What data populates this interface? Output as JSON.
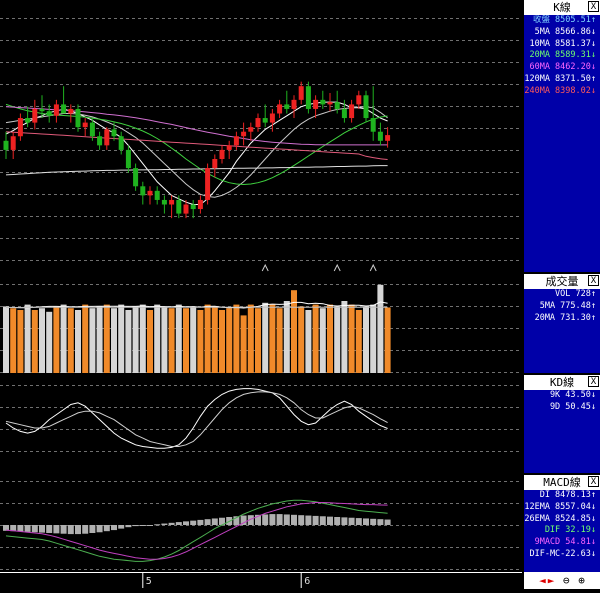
{
  "colors": {
    "up": "#ee2222",
    "down": "#1fb31f",
    "vol_up": "#f08a2a",
    "vol_down": "#d6d6d6",
    "grid": "#707070",
    "panel_bg": "#0000a8",
    "ma5": "#ffffff",
    "ma10": "#c8c8c8",
    "ma20": "#3fd13f",
    "ma60": "#d070d0",
    "ma120": "#e0e0e0",
    "ma240": "#e05a7a",
    "macd_bar": "#b0b0b0",
    "dif": "#4caf50",
    "macd": "#c040c0"
  },
  "k_panel": {
    "title": "K線",
    "close_btn": "X",
    "rows": [
      {
        "text": "收盤 8505.51↑",
        "color": "#7fd4ff"
      },
      {
        "text": "5MA 8566.86↓",
        "color": "#ffffff"
      },
      {
        "text": "10MA 8581.37↓",
        "color": "#ffffff"
      },
      {
        "text": "20MA 8589.31↓",
        "color": "#6fff6f"
      },
      {
        "text": "60MA 8462.20↓",
        "color": "#ff66ff"
      },
      {
        "text": "120MA 8371.50↑",
        "color": "#ffffff"
      },
      {
        "text": "240MA 8398.02↓",
        "color": "#ff5a5a"
      }
    ]
  },
  "vol_panel": {
    "title": "成交量",
    "close_btn": "X",
    "rows": [
      {
        "text": "VOL 728↑",
        "color": "#ffffff"
      },
      {
        "text": "5MA 775.48↑",
        "color": "#ffffff"
      },
      {
        "text": "20MA 731.30↑",
        "color": "#ffffff"
      }
    ]
  },
  "kd_panel": {
    "title": "KD線",
    "close_btn": "X",
    "rows": [
      {
        "text": "9K 43.50↓",
        "color": "#ffffff"
      },
      {
        "text": "9D 50.45↓",
        "color": "#ffffff"
      }
    ]
  },
  "macd_panel": {
    "title": "MACD線",
    "close_btn": "X",
    "rows": [
      {
        "text": "DI 8478.13↑",
        "color": "#ffffff"
      },
      {
        "text": "12EMA 8557.04↓",
        "color": "#ffffff"
      },
      {
        "text": "26EMA 8524.85↓",
        "color": "#ffffff"
      },
      {
        "text": "DIF 32.19↓",
        "color": "#6fff6f"
      },
      {
        "text": "9MACD 54.81↓",
        "color": "#ff66ff"
      },
      {
        "text": "DIF-MC-22.63↓",
        "color": "#ffffff"
      }
    ]
  },
  "toolbar": {
    "left": "◄",
    "right": "►",
    "zoom_out": "⊖",
    "zoom_in": "⊕"
  },
  "chart_data": {
    "type": "candlestick",
    "x_ticks": [
      {
        "label": "5",
        "index": 19
      },
      {
        "label": "6",
        "index": 41
      }
    ],
    "candles": [
      [
        8480,
        8520,
        8400,
        8440
      ],
      [
        8440,
        8520,
        8400,
        8500
      ],
      [
        8500,
        8600,
        8480,
        8580
      ],
      [
        8580,
        8630,
        8540,
        8560
      ],
      [
        8560,
        8660,
        8530,
        8620
      ],
      [
        8620,
        8680,
        8580,
        8610
      ],
      [
        8610,
        8640,
        8560,
        8590
      ],
      [
        8590,
        8660,
        8560,
        8640
      ],
      [
        8640,
        8720,
        8600,
        8600
      ],
      [
        8600,
        8640,
        8560,
        8620
      ],
      [
        8620,
        8640,
        8520,
        8540
      ],
      [
        8540,
        8580,
        8500,
        8560
      ],
      [
        8560,
        8580,
        8480,
        8500
      ],
      [
        8500,
        8520,
        8440,
        8460
      ],
      [
        8460,
        8540,
        8440,
        8530
      ],
      [
        8530,
        8560,
        8480,
        8500
      ],
      [
        8500,
        8520,
        8420,
        8440
      ],
      [
        8440,
        8460,
        8340,
        8360
      ],
      [
        8360,
        8380,
        8260,
        8280
      ],
      [
        8280,
        8300,
        8200,
        8240
      ],
      [
        8240,
        8280,
        8200,
        8260
      ],
      [
        8260,
        8280,
        8200,
        8220
      ],
      [
        8220,
        8240,
        8160,
        8200
      ],
      [
        8200,
        8240,
        8140,
        8220
      ],
      [
        8220,
        8240,
        8140,
        8160
      ],
      [
        8160,
        8220,
        8140,
        8200
      ],
      [
        8200,
        8220,
        8140,
        8180
      ],
      [
        8180,
        8240,
        8160,
        8220
      ],
      [
        8220,
        8380,
        8200,
        8360
      ],
      [
        8360,
        8420,
        8320,
        8400
      ],
      [
        8400,
        8460,
        8380,
        8440
      ],
      [
        8440,
        8480,
        8400,
        8460
      ],
      [
        8460,
        8520,
        8440,
        8500
      ],
      [
        8500,
        8560,
        8460,
        8520
      ],
      [
        8520,
        8560,
        8480,
        8540
      ],
      [
        8540,
        8600,
        8520,
        8580
      ],
      [
        8580,
        8640,
        8540,
        8560
      ],
      [
        8560,
        8620,
        8520,
        8600
      ],
      [
        8600,
        8660,
        8580,
        8640
      ],
      [
        8640,
        8700,
        8600,
        8620
      ],
      [
        8620,
        8680,
        8580,
        8660
      ],
      [
        8660,
        8740,
        8640,
        8720
      ],
      [
        8720,
        8740,
        8600,
        8620
      ],
      [
        8620,
        8680,
        8580,
        8660
      ],
      [
        8660,
        8700,
        8620,
        8640
      ],
      [
        8640,
        8690,
        8610,
        8650
      ],
      [
        8650,
        8700,
        8600,
        8620
      ],
      [
        8620,
        8660,
        8560,
        8580
      ],
      [
        8580,
        8660,
        8560,
        8640
      ],
      [
        8640,
        8700,
        8620,
        8680
      ],
      [
        8680,
        8700,
        8560,
        8580
      ],
      [
        8580,
        8720,
        8480,
        8520
      ],
      [
        8520,
        8560,
        8460,
        8480
      ],
      [
        8480,
        8540,
        8450,
        8505
      ]
    ],
    "ma_lines": [
      {
        "key": "ma5",
        "values": [
          8510,
          8525,
          8545,
          8560,
          8580,
          8590,
          8605,
          8610,
          8620,
          8610,
          8600,
          8585,
          8570,
          8550,
          8530,
          8515,
          8495,
          8460,
          8420,
          8380,
          8340,
          8300,
          8270,
          8240,
          8225,
          8210,
          8200,
          8200,
          8225,
          8260,
          8300,
          8340,
          8390,
          8430,
          8470,
          8500,
          8530,
          8550,
          8570,
          8590,
          8610,
          8630,
          8640,
          8645,
          8650,
          8650,
          8650,
          8640,
          8625,
          8625,
          8620,
          8600,
          8580,
          8567
        ]
      },
      {
        "key": "ma10",
        "values": [
          8560,
          8565,
          8570,
          8575,
          8580,
          8585,
          8590,
          8595,
          8600,
          8600,
          8598,
          8592,
          8585,
          8575,
          8563,
          8550,
          8535,
          8515,
          8495,
          8470,
          8440,
          8410,
          8380,
          8350,
          8320,
          8290,
          8265,
          8245,
          8235,
          8232,
          8240,
          8255,
          8275,
          8300,
          8330,
          8365,
          8400,
          8435,
          8470,
          8500,
          8530,
          8555,
          8575,
          8590,
          8600,
          8610,
          8618,
          8622,
          8625,
          8628,
          8630,
          8625,
          8605,
          8581
        ]
      },
      {
        "key": "ma20",
        "values": [
          8640,
          8630,
          8620,
          8612,
          8606,
          8600,
          8596,
          8593,
          8591,
          8589,
          8587,
          8584,
          8580,
          8575,
          8570,
          8563,
          8556,
          8547,
          8536,
          8523,
          8508,
          8490,
          8470,
          8448,
          8425,
          8400,
          8378,
          8356,
          8337,
          8320,
          8306,
          8296,
          8290,
          8288,
          8290,
          8296,
          8305,
          8318,
          8334,
          8352,
          8372,
          8392,
          8413,
          8434,
          8455,
          8475,
          8495,
          8515,
          8532,
          8548,
          8563,
          8575,
          8584,
          8589
        ]
      },
      {
        "key": "ma60",
        "values": [
          8630,
          8628,
          8626,
          8624,
          8622,
          8620,
          8618,
          8616,
          8614,
          8612,
          8610,
          8607,
          8604,
          8601,
          8597,
          8594,
          8590,
          8586,
          8581,
          8576,
          8570,
          8564,
          8558,
          8552,
          8545,
          8538,
          8531,
          8524,
          8518,
          8512,
          8506,
          8500,
          8495,
          8490,
          8485,
          8481,
          8477,
          8474,
          8471,
          8469,
          8467,
          8465,
          8464,
          8463,
          8463,
          8462,
          8462,
          8462,
          8462,
          8462,
          8462,
          8462,
          8462,
          8462
        ]
      },
      {
        "key": "ma120",
        "values": [
          8330,
          8332,
          8334,
          8336,
          8338,
          8340,
          8342,
          8343,
          8344,
          8345,
          8346,
          8347,
          8348,
          8349,
          8350,
          8350,
          8351,
          8351,
          8352,
          8352,
          8353,
          8353,
          8354,
          8354,
          8355,
          8355,
          8356,
          8356,
          8357,
          8357,
          8358,
          8358,
          8359,
          8359,
          8360,
          8360,
          8361,
          8361,
          8362,
          8362,
          8363,
          8364,
          8364,
          8365,
          8365,
          8366,
          8367,
          8367,
          8368,
          8369,
          8369,
          8370,
          8371,
          8371
        ]
      },
      {
        "key": "ma240",
        "values": [
          8520,
          8518,
          8516,
          8514,
          8512,
          8510,
          8508,
          8506,
          8504,
          8502,
          8500,
          8498,
          8496,
          8494,
          8492,
          8490,
          8488,
          8486,
          8484,
          8482,
          8480,
          8478,
          8476,
          8474,
          8472,
          8470,
          8468,
          8466,
          8464,
          8462,
          8460,
          8458,
          8456,
          8454,
          8452,
          8450,
          8448,
          8446,
          8444,
          8442,
          8440,
          8438,
          8436,
          8434,
          8432,
          8430,
          8428,
          8426,
          8424,
          8422,
          8412,
          8406,
          8401,
          8398
        ]
      }
    ],
    "k_ylim": [
      8000,
      8800
    ],
    "volume": [
      740,
      720,
      700,
      760,
      700,
      720,
      680,
      740,
      760,
      720,
      700,
      760,
      720,
      740,
      760,
      720,
      760,
      700,
      740,
      760,
      700,
      760,
      740,
      720,
      760,
      720,
      740,
      700,
      760,
      740,
      700,
      720,
      760,
      640,
      760,
      720,
      780,
      760,
      720,
      800,
      920,
      740,
      700,
      760,
      720,
      760,
      740,
      800,
      760,
      700,
      740,
      760,
      980,
      728
    ],
    "vol_ma5": [
      730,
      728,
      726,
      726,
      730,
      736,
      740,
      740,
      738,
      736,
      736,
      740,
      740,
      742,
      742,
      742,
      742,
      740,
      740,
      744,
      738,
      740,
      738,
      736,
      740,
      736,
      738,
      732,
      740,
      742,
      730,
      724,
      728,
      722,
      730,
      740,
      760,
      766,
      762,
      766,
      784,
      784,
      770,
      776,
      770,
      750,
      744,
      750,
      752,
      752,
      744,
      750,
      790,
      775
    ],
    "vol_ma20": [
      728,
      728,
      728,
      729,
      729,
      730,
      730,
      731,
      731,
      731,
      731,
      731,
      731,
      731,
      731,
      731,
      731,
      731,
      731,
      731,
      731,
      731,
      731,
      731,
      731,
      731,
      731,
      731,
      731,
      731,
      731,
      731,
      731,
      731,
      731,
      731,
      731,
      731,
      731,
      731,
      731,
      731,
      731,
      731,
      731,
      731,
      731,
      731,
      731,
      731,
      731,
      731,
      731,
      731
    ],
    "vol_ylim": [
      0,
      1000
    ],
    "kd_k": [
      50,
      44,
      40,
      38,
      40,
      46,
      54,
      60,
      66,
      72,
      74,
      70,
      62,
      54,
      46,
      38,
      32,
      28,
      24,
      22,
      21,
      20,
      20,
      21,
      24,
      32,
      44,
      58,
      70,
      78,
      84,
      88,
      90,
      91,
      91,
      90,
      88,
      86,
      80,
      70,
      60,
      52,
      48,
      50,
      58,
      66,
      72,
      76,
      72,
      64,
      58,
      52,
      47,
      43.5
    ],
    "kd_d": [
      52,
      50,
      48,
      46,
      44,
      44,
      46,
      50,
      54,
      58,
      62,
      64,
      64,
      62,
      58,
      54,
      48,
      42,
      36,
      32,
      28,
      26,
      24,
      22,
      22,
      24,
      28,
      36,
      46,
      56,
      66,
      74,
      80,
      84,
      86,
      87,
      87,
      86,
      84,
      80,
      74,
      66,
      60,
      56,
      56,
      60,
      64,
      68,
      70,
      68,
      64,
      60,
      55,
      50.45
    ],
    "kd_ylim": [
      0,
      100
    ],
    "macd_hist": [
      -16,
      -17,
      -18,
      -19,
      -20,
      -21,
      -22,
      -23,
      -24,
      -25,
      -25,
      -24,
      -22,
      -20,
      -17,
      -14,
      -10,
      -6,
      -3,
      -1,
      0,
      2,
      4,
      6,
      8,
      10,
      12,
      14,
      16,
      18,
      20,
      22,
      24,
      26,
      27,
      28,
      29,
      30,
      30,
      29,
      28,
      27,
      26,
      25,
      24,
      23,
      22,
      21,
      20,
      19,
      18,
      17,
      16,
      15
    ],
    "macd_dif": [
      -30,
      -32,
      -34,
      -36,
      -38,
      -40,
      -44,
      -50,
      -56,
      -62,
      -68,
      -74,
      -80,
      -86,
      -90,
      -94,
      -96,
      -98,
      -100,
      -100,
      -98,
      -94,
      -88,
      -80,
      -70,
      -58,
      -46,
      -34,
      -22,
      -10,
      0,
      10,
      20,
      30,
      38,
      46,
      52,
      58,
      62,
      66,
      68,
      68,
      66,
      64,
      60,
      56,
      52,
      48,
      44,
      40,
      38,
      36,
      34,
      32.19
    ],
    "macd_signal": [
      -14,
      -16,
      -18,
      -20,
      -22,
      -24,
      -28,
      -33,
      -39,
      -45,
      -51,
      -57,
      -63,
      -69,
      -74,
      -78,
      -82,
      -86,
      -90,
      -92,
      -94,
      -94,
      -92,
      -88,
      -82,
      -74,
      -64,
      -54,
      -44,
      -34,
      -24,
      -14,
      -4,
      6,
      16,
      24,
      32,
      38,
      44,
      50,
      54,
      58,
      60,
      62,
      62,
      61,
      60,
      59,
      58,
      57,
      56,
      56,
      55,
      54.81
    ],
    "macd_ylim": [
      -110,
      110
    ]
  }
}
